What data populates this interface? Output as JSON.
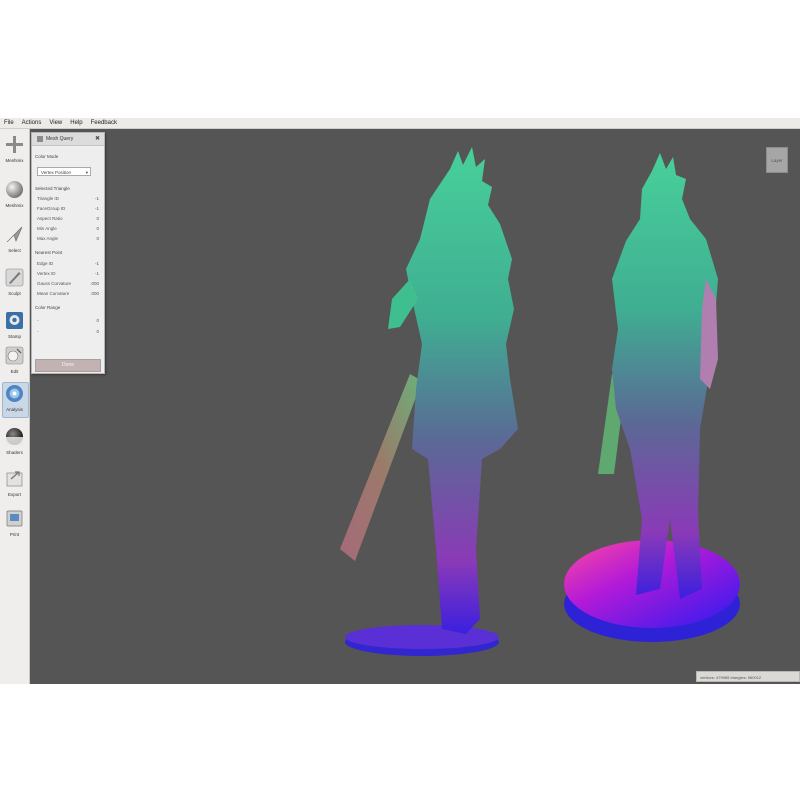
{
  "menu": [
    "File",
    "Actions",
    "View",
    "Help",
    "Feedback"
  ],
  "toolbar": [
    {
      "label": "Meshmix",
      "icon": "plus-icon"
    },
    {
      "label": "Meshmix",
      "icon": "sphere-icon"
    },
    {
      "label": "Select",
      "icon": "arrow-cursor-icon"
    },
    {
      "label": "Sculpt",
      "icon": "brush-icon"
    },
    {
      "label": "Stamp",
      "icon": "stamp-icon"
    },
    {
      "label": "Edit",
      "icon": "edit-icon"
    },
    {
      "label": "Analysis",
      "icon": "analysis-icon",
      "active": true
    },
    {
      "label": "Shaders",
      "icon": "shaders-icon"
    },
    {
      "label": "Export",
      "icon": "export-icon"
    },
    {
      "label": "Print",
      "icon": "print-icon"
    }
  ],
  "panel": {
    "title": "Mesh Query",
    "close": "✖",
    "color_mode_label": "Color Mode",
    "color_mode_value": "Vertex Position",
    "selected_triangle_label": "Selected Triangle",
    "triangle_rows": [
      {
        "label": "Triangle ID",
        "value": "-1"
      },
      {
        "label": "FaceGroup ID",
        "value": "-1"
      },
      {
        "label": "Aspect Ratio",
        "value": "0"
      },
      {
        "label": "Min Angle",
        "value": "0"
      },
      {
        "label": "Max Angle",
        "value": "0"
      }
    ],
    "nearest_point_label": "Nearest Point",
    "point_rows": [
      {
        "label": "Edge ID",
        "value": "-1"
      },
      {
        "label": "Vertex ID",
        "value": "-1"
      },
      {
        "label": "Gauss Curvature",
        "value": ".000"
      },
      {
        "label": "Mean Curvature",
        "value": ".000"
      }
    ],
    "color_range_label": "Color Range",
    "range_rows": [
      {
        "label": "-",
        "value": "0"
      },
      {
        "label": "-",
        "value": "0"
      }
    ],
    "done_label": "Done"
  },
  "viewport": {
    "background": "#555555",
    "corner_button": "Layer"
  },
  "status_text": "vertices: 479985 triangles: 960012",
  "colors": {
    "active_tool": "#c9d7e6",
    "done_button": "#c3b2b2",
    "model_top": "#3fc79a",
    "model_bottom": "#3b1fe0"
  }
}
